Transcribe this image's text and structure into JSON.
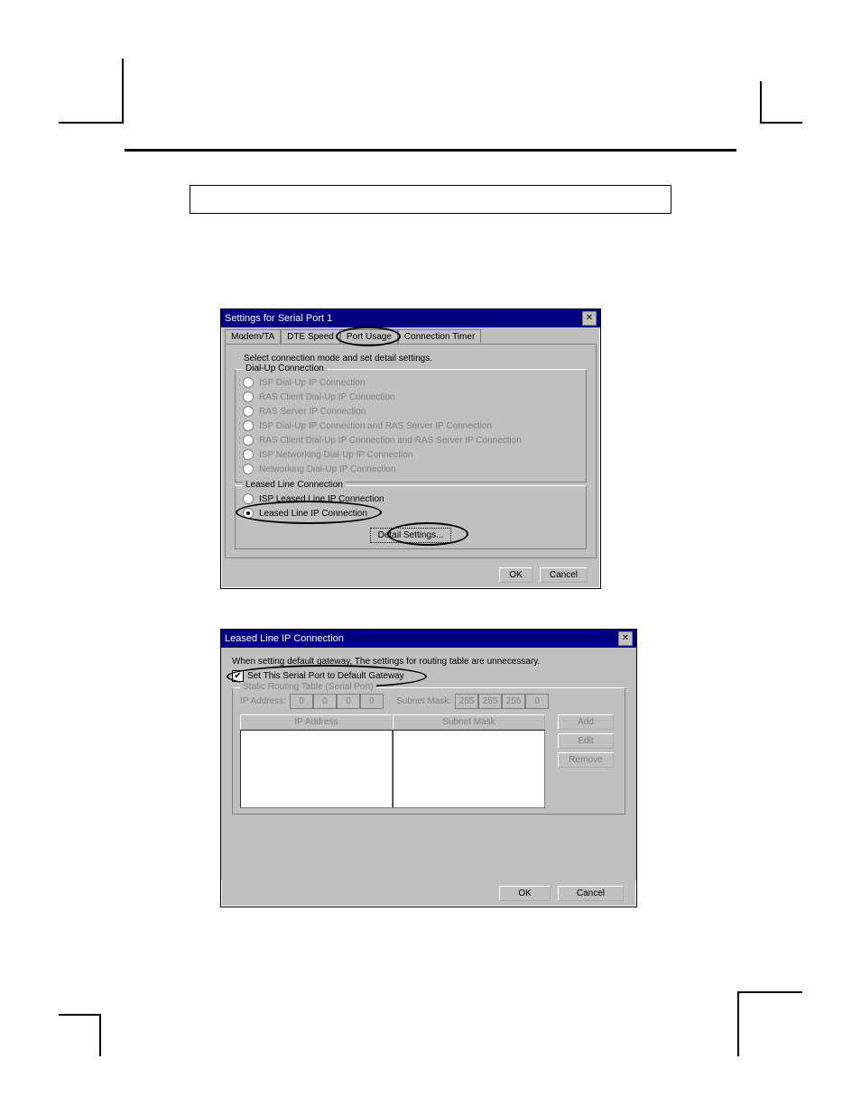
{
  "dialog1": {
    "title": "Settings for Serial Port 1",
    "tabs": [
      "Modem/TA",
      "DTE Speed",
      "Port Usage",
      "Connection Timer"
    ],
    "instruction": "Select connection mode and set detail settings.",
    "group_dialup": {
      "label": "Dial-Up Connection",
      "options": [
        "ISP Dial-Up IP Connection",
        "RAS Client Dial-Up IP Connection",
        "RAS Server IP Connection",
        "ISP Dial-Up IP Connection and RAS Server IP Connection",
        "RAS Client Dial-Up IP Connection and RAS Server IP Connection",
        "ISP Networking Dial-Up IP Connection",
        "Networking Dial-Up IP Connection"
      ]
    },
    "group_leased": {
      "label": "Leased Line Connection",
      "options": [
        "ISP Leased Line IP Connection",
        "Leased Line IP Connection"
      ],
      "selected_index": 1
    },
    "detail_button": "Detail Settings...",
    "ok": "OK",
    "cancel": "Cancel"
  },
  "dialog2": {
    "title": "Leased Line IP Connection",
    "note": "When setting default gateway, The settings for routing table are unnecessary.",
    "checkbox_label": "Set This Serial Port to Default Gateway",
    "checkbox_checked": true,
    "group_static": {
      "label": "Static Routing Table (Serial Port)",
      "ip_label": "IP Address:",
      "subnet_label": "Subnet Mask:",
      "ip_values": [
        "0",
        "0",
        "0",
        "0"
      ],
      "mask_values": [
        "255",
        "255",
        "255",
        "0"
      ],
      "col_ip": "IP Address",
      "col_mask": "Subnet Mask",
      "add": "Add",
      "edit": "Edit",
      "remove": "Remove"
    },
    "ok": "OK",
    "cancel": "Cancel"
  }
}
